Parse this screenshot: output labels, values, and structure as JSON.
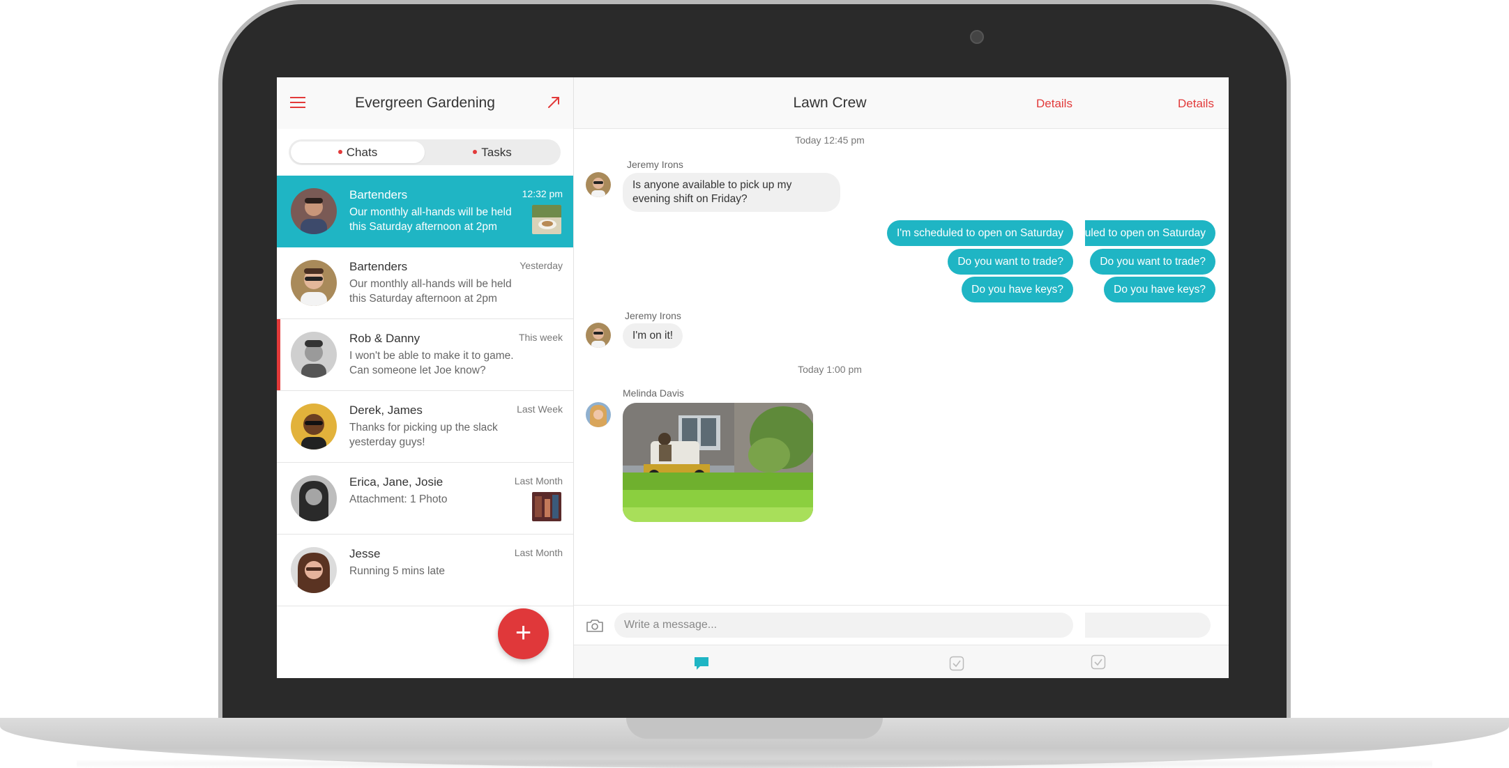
{
  "sidebar": {
    "title": "Evergreen Gardening",
    "tabs": [
      {
        "label": "Chats",
        "active": true
      },
      {
        "label": "Tasks",
        "active": false
      }
    ],
    "chats": [
      {
        "name": "Bartenders",
        "time": "12:32 pm",
        "preview": "Our monthly all-hands will be held this Saturday afternoon at 2pm",
        "selected": true,
        "has_thumbnail": true
      },
      {
        "name": "Bartenders",
        "time": "Yesterday",
        "preview": "Our monthly all-hands will be held this Saturday afternoon at 2pm"
      },
      {
        "name": "Rob & Danny",
        "time": "This week",
        "preview": "I won't be able to make it to game. Can someone let Joe know?",
        "flagged": true
      },
      {
        "name": "Derek, James",
        "time": "Last Week",
        "preview": "Thanks for picking up the slack yesterday guys!"
      },
      {
        "name": "Erica, Jane, Josie",
        "time": "Last Month",
        "preview": "Attachment: 1 Photo",
        "has_thumbnail": true
      },
      {
        "name": "Jesse",
        "time": "Last Month",
        "preview": "Running 5 mins late"
      }
    ],
    "fab_label": "+"
  },
  "conversation": {
    "title": "Lawn Crew",
    "details_label": "Details",
    "details_label_2": "Details",
    "messages": {
      "ts1": "Today 12:45 pm",
      "sender1": "Jeremy Irons",
      "text1": "Is anyone available to pick up my evening shift on Friday?",
      "out1": "I'm scheduled to open on Saturday",
      "out2": "Do you want to trade?",
      "out3": "Do you have keys?",
      "sender2": "Jeremy Irons",
      "text2": "I'm on it!",
      "ts2": "Today 1:00 pm",
      "sender3": "Melinda Davis"
    },
    "input_placeholder": "Write a message..."
  },
  "colors": {
    "accent_teal": "#1fb5c4",
    "accent_red": "#e23a3a"
  }
}
